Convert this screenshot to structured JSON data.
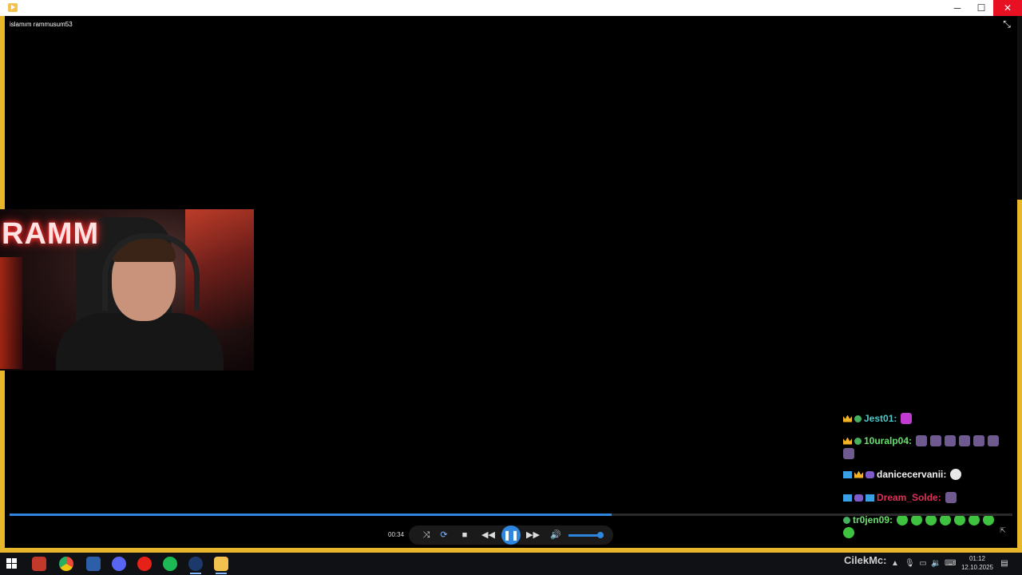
{
  "window": {
    "minimize_glyph": "─",
    "maximize_glyph": "☐",
    "close_glyph": "✕"
  },
  "video": {
    "title": "islamım rammusum53",
    "current_time": "00:34",
    "progress": 0.6
  },
  "webcam": {
    "sign_text": "RAMM"
  },
  "chat": {
    "messages": [
      {
        "user": "Jest01:",
        "color": "#4ec9c9",
        "badges": [
          "crown",
          "sub"
        ],
        "emotes": [
          "pink"
        ]
      },
      {
        "user": "10uralp04:",
        "color": "#66e06b",
        "badges": [
          "crown",
          "sub"
        ],
        "emotes": [
          "purple",
          "purple",
          "purple",
          "purple",
          "purple",
          "purple",
          "purple"
        ]
      },
      {
        "user": "danicecervanii:",
        "color": "#f2f2f2",
        "badges": [
          "blue",
          "crown",
          "purple"
        ],
        "emotes": [
          "white"
        ]
      },
      {
        "user": "Dream_Solde:",
        "color": "#e0305a",
        "badges": [
          "blue",
          "purple",
          "blue"
        ],
        "emotes": [
          "purple"
        ]
      },
      {
        "user": "tr0jen09:",
        "color": "#66e06b",
        "badges": [
          "sub"
        ],
        "emotes": [
          "green",
          "green",
          "green",
          "green",
          "green",
          "green",
          "green",
          "green"
        ]
      }
    ]
  },
  "player": {
    "volume": 0.9
  },
  "taskbar": {
    "user": "CilekMc:",
    "time": "01:12",
    "date": "12.10.2025",
    "apps": [
      "photo-editor",
      "chrome",
      "file-manager",
      "discord",
      "youtube",
      "spotify",
      "steam",
      "media-player"
    ]
  },
  "colors": {
    "accent": "#2e86de",
    "frame": "#e8b62a",
    "close": "#e81123"
  }
}
